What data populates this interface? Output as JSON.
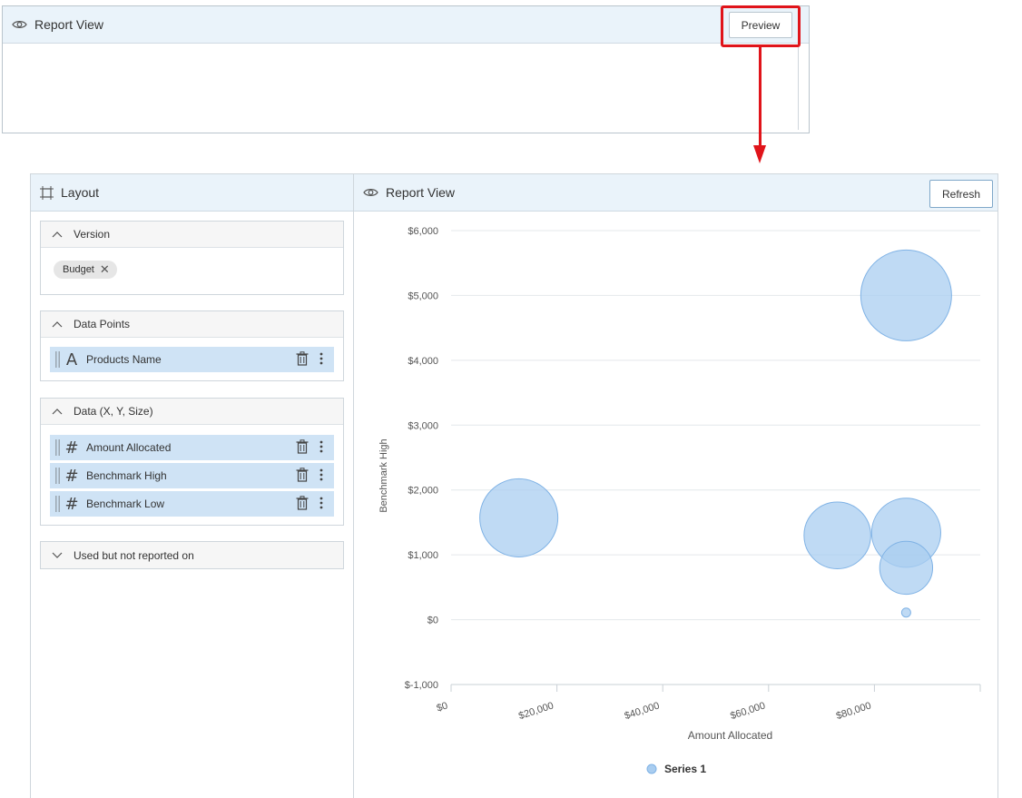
{
  "top_panel": {
    "title": "Report View",
    "preview_label": "Preview"
  },
  "layout": {
    "title": "Layout",
    "sections": {
      "version": {
        "label": "Version",
        "chip": "Budget"
      },
      "data_points": {
        "label": "Data Points",
        "fields": [
          "Products Name"
        ]
      },
      "data_xyz": {
        "label": "Data (X, Y, Size)",
        "fields": [
          "Amount Allocated",
          "Benchmark High",
          "Benchmark Low"
        ]
      },
      "unused": {
        "label": "Used but not reported on"
      }
    }
  },
  "report": {
    "title": "Report View",
    "refresh_label": "Refresh"
  },
  "colors": {
    "highlight": "#e0141a",
    "bubble_fill": "#a9cdf0",
    "bubble_stroke": "#7fb2e5",
    "header_bg": "#eaf3fa"
  },
  "chart_data": {
    "type": "bubble",
    "xlabel": "Amount Allocated",
    "ylabel": "Benchmark High",
    "xlim": [
      0,
      100000
    ],
    "ylim": [
      -1000,
      6000
    ],
    "x_ticks": [
      "$0",
      "$20,000",
      "$40,000",
      "$60,000",
      "$80,000"
    ],
    "x_tick_values": [
      0,
      20000,
      40000,
      60000,
      80000
    ],
    "y_ticks": [
      "$-1,000",
      "$0",
      "$1,000",
      "$2,000",
      "$3,000",
      "$4,000",
      "$5,000",
      "$6,000"
    ],
    "y_tick_values": [
      -1000,
      0,
      1000,
      2000,
      3000,
      4000,
      5000,
      6000
    ],
    "legend": {
      "position": "bottom",
      "entries": [
        "Series 1"
      ]
    },
    "series": [
      {
        "name": "Series 1",
        "points": [
          {
            "x": 86000,
            "y": 5000,
            "size": 5000
          },
          {
            "x": 12800,
            "y": 1570,
            "size": 3700
          },
          {
            "x": 73000,
            "y": 1300,
            "size": 2700
          },
          {
            "x": 86000,
            "y": 1340,
            "size": 2900
          },
          {
            "x": 86000,
            "y": 800,
            "size": 1700
          },
          {
            "x": 86000,
            "y": 110,
            "size": 50
          }
        ]
      }
    ]
  }
}
